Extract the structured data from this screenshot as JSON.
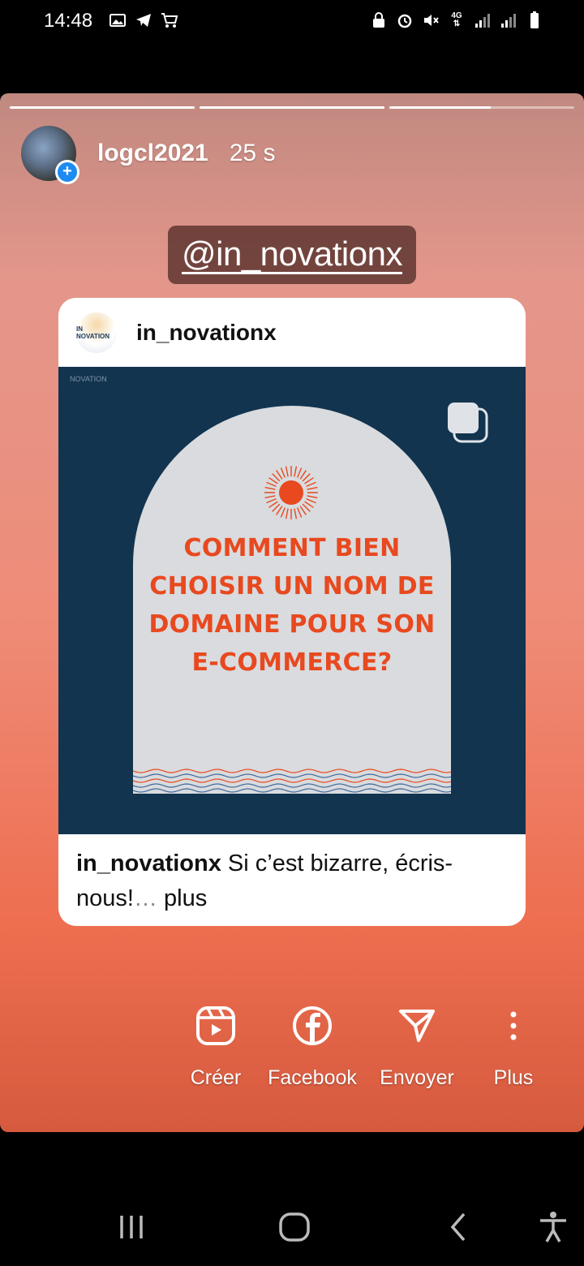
{
  "status_bar": {
    "time": "14:48",
    "left_icons": [
      "gallery-icon",
      "telegram-icon",
      "cart-icon"
    ],
    "right_icons": [
      "lock-icon",
      "alarm-icon",
      "mute-icon",
      "4g-icon",
      "signal-icon",
      "signal-icon-2",
      "battery-icon"
    ],
    "network_label": "4G"
  },
  "story": {
    "progress_segments": [
      1.0,
      1.0,
      0.55
    ],
    "username": "logcl2021",
    "time_ago": "25 s",
    "mention": "@in_novationx"
  },
  "post": {
    "username": "in_novationx",
    "avatar_text": "IN NOVATION",
    "image_logo_text": "NOVATION",
    "headline_lines": [
      "COMMENT BIEN",
      "CHOISIR UN NOM DE",
      "DOMAINE POUR SON",
      "E-COMMERCE?"
    ],
    "caption_user": "in_novationx",
    "caption_text": " Si c’est bizarre, écris-nous!",
    "caption_ellipsis": "…",
    "caption_more": " plus"
  },
  "actions": [
    {
      "label": "Créer",
      "icon": "reels-icon"
    },
    {
      "label": "Facebook",
      "icon": "facebook-icon"
    },
    {
      "label": "Envoyer",
      "icon": "send-icon"
    },
    {
      "label": "Plus",
      "icon": "more-icon"
    }
  ],
  "navbar": {
    "buttons": [
      "recents-icon",
      "home-icon",
      "back-icon",
      "accessibility-icon"
    ]
  },
  "colors": {
    "headline": "#e8491f",
    "post_background": "#12344f",
    "arch": "#d9dbde",
    "badge_blue": "#1d8bf1"
  }
}
